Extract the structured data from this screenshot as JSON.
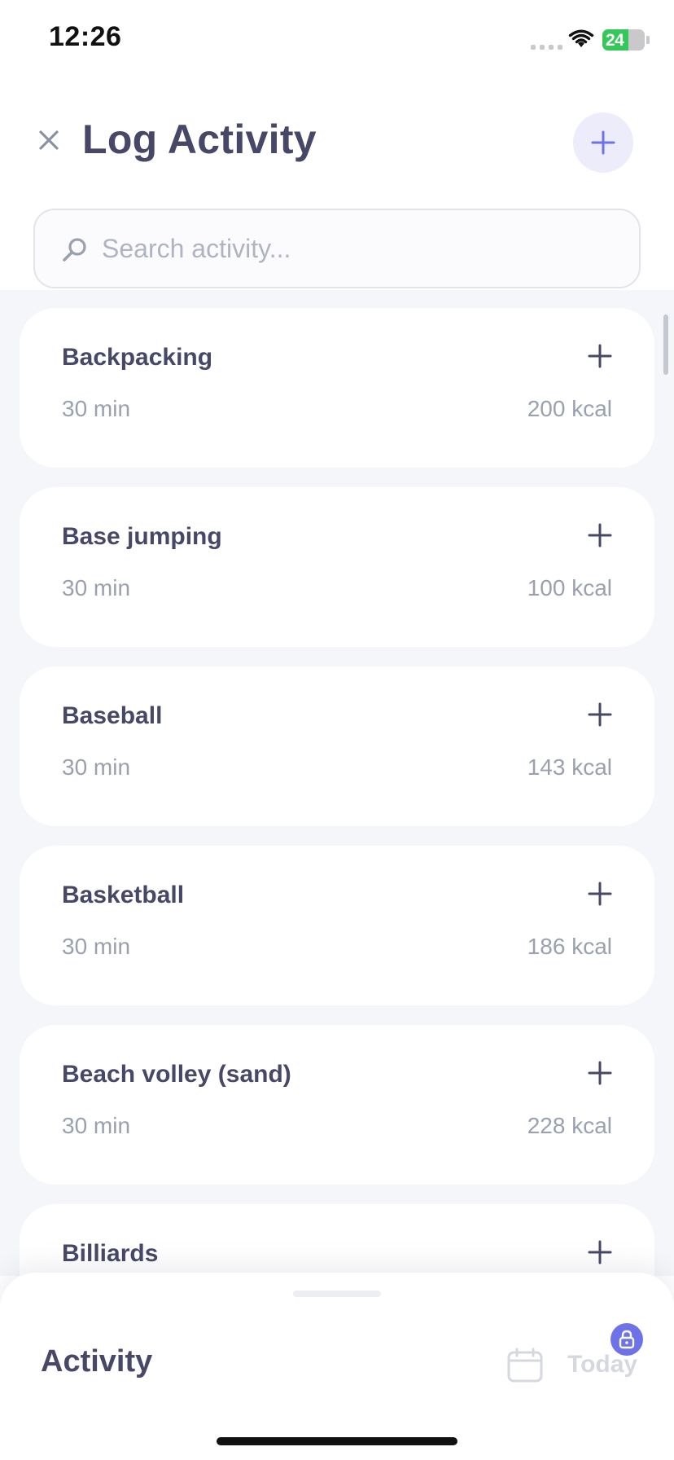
{
  "status_bar": {
    "time": "12:26",
    "battery_text": "24",
    "battery_level": 0.24,
    "battery_color": "#34c759"
  },
  "header": {
    "title": "Log Activity",
    "close_icon": "close-icon",
    "add_icon": "plus-icon"
  },
  "search": {
    "placeholder": "Search activity...",
    "value": "",
    "icon": "search-icon"
  },
  "activities": [
    {
      "name": "Backpacking",
      "duration": "30 min",
      "kcal": "200 kcal"
    },
    {
      "name": "Base jumping",
      "duration": "30 min",
      "kcal": "100 kcal"
    },
    {
      "name": "Baseball",
      "duration": "30 min",
      "kcal": "143 kcal"
    },
    {
      "name": "Basketball",
      "duration": "30 min",
      "kcal": "186 kcal"
    },
    {
      "name": "Beach volley (sand)",
      "duration": "30 min",
      "kcal": "228 kcal"
    },
    {
      "name": "Billiards",
      "duration": "",
      "kcal": ""
    }
  ],
  "bottom_sheet": {
    "title": "Activity",
    "date_label": "Today",
    "calendar_icon": "calendar-icon",
    "lock_icon": "lock-icon"
  },
  "colors": {
    "primary_text": "#474867",
    "muted_text": "#9aa0ad",
    "accent": "#6d72e8",
    "accent_soft": "#ececfb"
  }
}
